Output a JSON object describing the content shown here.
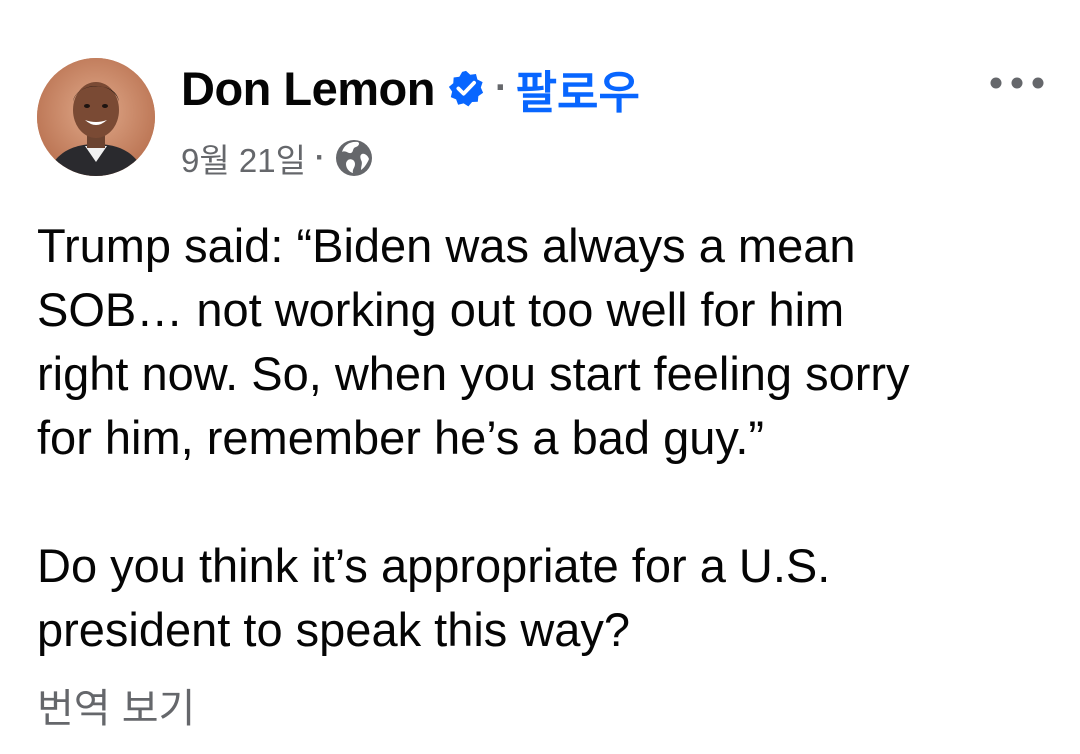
{
  "post": {
    "author": {
      "name": "Don Lemon",
      "verified_icon": "verified-badge-icon",
      "follow_label": "팔로우",
      "separator": "·",
      "avatar_icon": "profile-photo"
    },
    "meta": {
      "timestamp": "9월 21일",
      "separator": "·",
      "audience_icon": "globe-icon"
    },
    "more_icon": "more-options-icon",
    "paragraphs": [
      "Trump said: “Biden was always a mean\nSOB… not working out too well for him\nright now. So, when you start feeling sorry\nfor him, remember he’s a bad guy.”",
      "Do you think it’s appropriate for a U.S.\npresident to speak this way?"
    ],
    "translate_label": "번역 보기"
  },
  "colors": {
    "text": "#050505",
    "secondary": "#65676b",
    "accent": "#0866ff",
    "background": "#ffffff"
  }
}
